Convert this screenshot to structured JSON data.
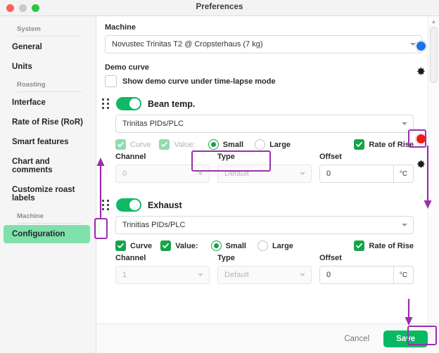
{
  "window": {
    "title": "Preferences",
    "traffic_lights": [
      "close-red",
      "minimize-grey",
      "zoom-green"
    ]
  },
  "sidebar": {
    "groups": [
      {
        "label": "System",
        "items": [
          {
            "label": "General",
            "active": false
          },
          {
            "label": "Units",
            "active": false
          }
        ]
      },
      {
        "label": "Roasting",
        "items": [
          {
            "label": "Interface",
            "active": false
          },
          {
            "label": "Rate of Rise (RoR)",
            "active": false
          },
          {
            "label": "Smart features",
            "active": false
          },
          {
            "label": "Chart and comments",
            "active": false
          },
          {
            "label": "Customize roast labels",
            "active": false
          }
        ]
      },
      {
        "label": "Machine",
        "items": [
          {
            "label": "Configuration",
            "active": true
          }
        ]
      }
    ],
    "active_color": "#7fe0ab"
  },
  "main": {
    "machine": {
      "label": "Machine",
      "value": "Novustec Trinitas T2 @ Cropsterhaus (7 kg)"
    },
    "demo_curve": {
      "label": "Demo curve",
      "checkbox_label": "Show demo curve under time-lapse mode",
      "checked": false
    },
    "devices": [
      {
        "name": "Bean temp.",
        "enabled": true,
        "status_color": "#1a73e8",
        "source": "Trinitas PIDs/PLC",
        "curve": {
          "label": "Curve",
          "checked": true,
          "disabled": true
        },
        "value": {
          "label": "Value:",
          "checked": true,
          "disabled": true
        },
        "size_options": [
          {
            "label": "Small",
            "selected": true
          },
          {
            "label": "Large",
            "selected": false
          }
        ],
        "rate_of_rise": {
          "label": "Rate of Rise",
          "checked": true
        },
        "channel": {
          "label": "Channel",
          "value": "0",
          "disabled": true
        },
        "type": {
          "label": "Type",
          "value": "Default",
          "disabled": true
        },
        "offset": {
          "label": "Offset",
          "value": "0",
          "unit": "°C"
        }
      },
      {
        "name": "Exhaust",
        "enabled": true,
        "status_color": "#f01c0f",
        "source": "Trinitias PIDs/PLC",
        "curve": {
          "label": "Curve",
          "checked": true,
          "disabled": false
        },
        "value": {
          "label": "Value:",
          "checked": true,
          "disabled": false
        },
        "size_options": [
          {
            "label": "Small",
            "selected": true
          },
          {
            "label": "Large",
            "selected": false
          }
        ],
        "rate_of_rise": {
          "label": "Rate of Rise",
          "checked": true
        },
        "channel": {
          "label": "Channel",
          "value": "1",
          "disabled": true
        },
        "type": {
          "label": "Type",
          "value": "Default",
          "disabled": true
        },
        "offset": {
          "label": "Offset",
          "value": "0",
          "unit": "°C"
        }
      }
    ]
  },
  "footer": {
    "cancel_label": "Cancel",
    "save_label": "Save"
  },
  "annotations": {
    "highlight_color": "#9b2fae",
    "targets": [
      "size-radio-group",
      "bean-gear-button",
      "exhaust-drag-handle",
      "save-button"
    ]
  }
}
